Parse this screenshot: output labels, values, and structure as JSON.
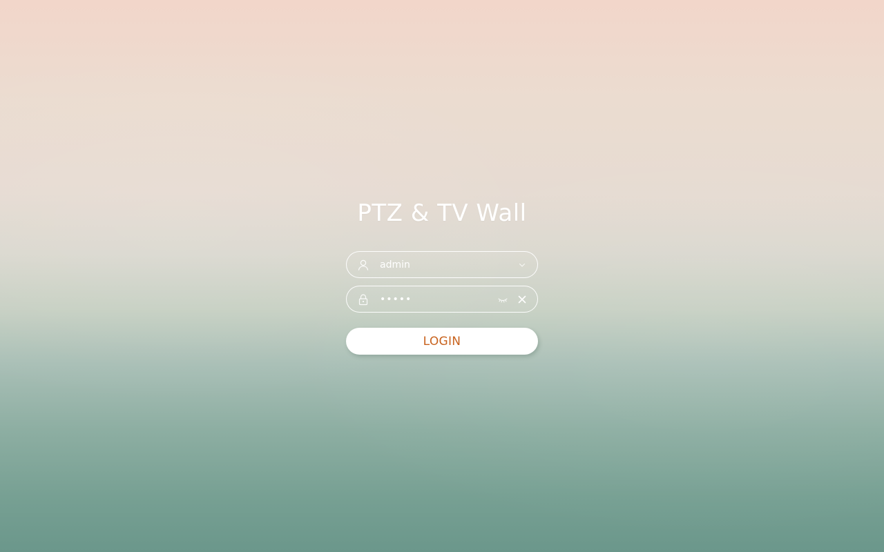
{
  "app": {
    "title": "PTZ & TV Wall"
  },
  "login": {
    "username_value": "admin",
    "password_mask": "•••••",
    "button_label": "LOGIN"
  },
  "icons": {
    "user": "user-icon",
    "dropdown": "chevron-down-icon",
    "lock": "lock-icon",
    "toggle_visibility": "eye-closed-icon",
    "clear": "close-icon"
  },
  "colors": {
    "button_text": "#c8621d",
    "foreground": "#ffffff"
  }
}
